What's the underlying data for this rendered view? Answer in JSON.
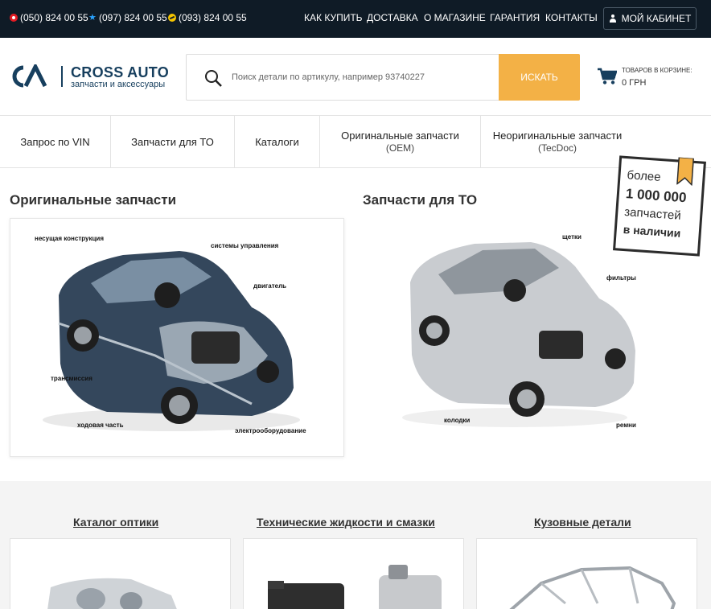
{
  "topbar": {
    "phones": [
      {
        "number": "(050) 824 00 55",
        "icon": "vodafone-icon"
      },
      {
        "number": "(097) 824 00 55",
        "icon": "kyivstar-icon"
      },
      {
        "number": "(093) 824 00 55",
        "icon": "lifecell-icon"
      }
    ],
    "nav": [
      "КАК КУПИТЬ",
      "ДОСТАВКА",
      "О МАГАЗИНЕ",
      "ГАРАНТИЯ",
      "КОНТАКТЫ"
    ],
    "cabinet_label": "МОЙ КАБИНЕТ"
  },
  "header": {
    "logo_name": "CROSS AUTO",
    "logo_tagline": "запчасти и аксессуары",
    "search_placeholder": "Поиск детали по артикулу, например 93740227",
    "search_button": "ИСКАТЬ",
    "cart_label": "ТОВАРОВ В КОРЗИНЕ:",
    "cart_sum": "0 ГРН"
  },
  "catnav": [
    {
      "label": "Запрос по VIN",
      "sub": ""
    },
    {
      "label": "Запчасти для ТО",
      "sub": ""
    },
    {
      "label": "Каталоги",
      "sub": ""
    },
    {
      "label": "Оригинальные запчасти",
      "sub": "(OEM)"
    },
    {
      "label": "Неоригинальные запчасти",
      "sub": "(TecDoc)"
    }
  ],
  "badge": {
    "line1": "более",
    "line2": "1 000 000",
    "line3": "запчастей",
    "line4": "в наличии"
  },
  "sections": {
    "original": {
      "title": "Оригинальные запчасти",
      "callouts": [
        "несущая конструкция",
        "системы управления",
        "двигатель",
        "трансмиссия",
        "ходовая часть",
        "электрооборудование"
      ]
    },
    "to": {
      "title": "Запчасти для ТО",
      "callouts": [
        "щетки",
        "фильтры",
        "колодки",
        "ремни"
      ]
    }
  },
  "bottom_categories": [
    "Каталог оптики",
    "Технические жидкости и смазки",
    "Кузовные детали"
  ],
  "colors": {
    "topbar": "#0f1b26",
    "accent": "#f3b146",
    "brand": "#173f5e"
  }
}
